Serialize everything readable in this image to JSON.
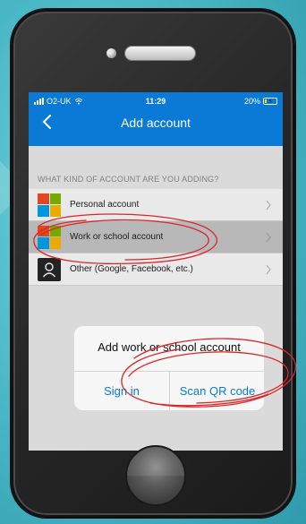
{
  "status_bar": {
    "carrier": "O2-UK",
    "time": "11:29",
    "battery": "20%",
    "battery_level": 0.2
  },
  "nav": {
    "title": "Add account",
    "back_icon": "chevron-left-icon"
  },
  "section_header": "WHAT KIND OF ACCOUNT ARE YOU ADDING?",
  "accounts": [
    {
      "label": "Personal account",
      "icon": "microsoft-logo-icon"
    },
    {
      "label": "Work or school account",
      "icon": "microsoft-logo-icon",
      "selected": true
    },
    {
      "label": "Other (Google, Facebook, etc.)",
      "icon": "person-icon"
    }
  ],
  "alert": {
    "title": "Add work or school account",
    "sign_in_label": "Sign in",
    "scan_qr_label": "Scan QR code"
  },
  "colors": {
    "accent": "#0a7ad6",
    "annotation": "#d9262a",
    "ms_red": "#f25022",
    "ms_green": "#7fba00",
    "ms_blue": "#00a4ef",
    "ms_yellow": "#ffb900"
  }
}
